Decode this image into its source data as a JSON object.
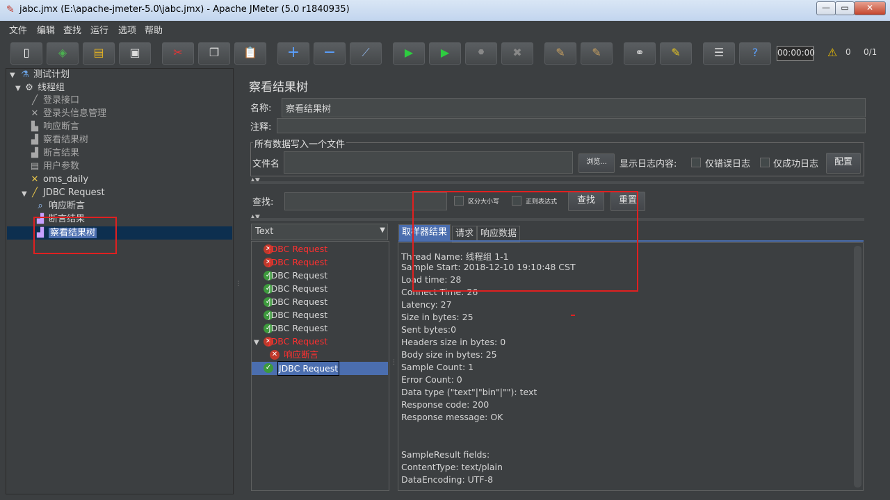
{
  "window": {
    "title": "jabc.jmx (E:\\apache-jmeter-5.0\\jabc.jmx) - Apache JMeter (5.0 r1840935)"
  },
  "menu": [
    "文件",
    "编辑",
    "查找",
    "运行",
    "选项",
    "帮助"
  ],
  "toolbar": {
    "timer": "00:00:00",
    "warning_count": "0",
    "thread_count": "0/1"
  },
  "tree": [
    {
      "label": "测试计划",
      "icon": "flask-icon"
    },
    {
      "label": "线程组",
      "icon": "gear-icon"
    },
    {
      "label": "登录接口",
      "icon": "pipette-icon"
    },
    {
      "label": "登录头信息管理",
      "icon": "tools-icon"
    },
    {
      "label": "响应断言",
      "icon": "stamp-icon"
    },
    {
      "label": "察看结果树",
      "icon": "graph-icon"
    },
    {
      "label": "断言结果",
      "icon": "graph-icon"
    },
    {
      "label": "用户参数",
      "icon": "doc-icon"
    },
    {
      "label": "oms_daily",
      "icon": "tools-icon"
    },
    {
      "label": "JDBC Request",
      "icon": "pipette-icon"
    },
    {
      "label": "响应断言",
      "icon": "magnifier-icon"
    },
    {
      "label": "断言结果",
      "icon": "graph-icon"
    },
    {
      "label": "察看结果树",
      "icon": "graph-icon"
    }
  ],
  "panel": {
    "title": "察看结果树",
    "name_label": "名称:",
    "name_value": "察看结果树",
    "comment_label": "注释:",
    "file_group": "所有数据写入一个文件",
    "filename_label": "文件名",
    "browse": "浏览...",
    "log_label": "显示日志内容:",
    "errors_only": "仅错误日志",
    "success_only": "仅成功日志",
    "configure": "配置",
    "search_label": "查找:",
    "case_sensitive": "区分大小写",
    "regex": "正则表达式",
    "find": "查找",
    "reset": "重置",
    "renderer": "Text",
    "tabs": [
      "取样器结果",
      "请求",
      "响应数据"
    ]
  },
  "results": [
    {
      "label": "JDBC Request",
      "status": "error"
    },
    {
      "label": "JDBC Request",
      "status": "error"
    },
    {
      "label": "JDBC Request",
      "status": "ok"
    },
    {
      "label": "JDBC Request",
      "status": "ok"
    },
    {
      "label": "JDBC Request",
      "status": "ok"
    },
    {
      "label": "JDBC Request",
      "status": "ok"
    },
    {
      "label": "JDBC Request",
      "status": "ok"
    },
    {
      "label": "JDBC Request",
      "status": "error"
    },
    {
      "label": "响应断言",
      "status": "error"
    },
    {
      "label": "JDBC Request",
      "status": "ok"
    }
  ],
  "sampler_result": [
    "Thread Name: 线程组 1-1",
    "Sample Start: 2018-12-10 19:10:48 CST",
    "Load time: 28",
    "Connect Time: 26",
    "Latency: 27",
    "Size in bytes: 25",
    "Sent bytes:0",
    "Headers size in bytes: 0",
    "Body size in bytes: 25",
    "Sample Count: 1",
    "Error Count: 0",
    "Data type (\"text\"|\"bin\"|\"\"): text",
    "Response code: 200",
    "Response message: OK",
    "",
    "SampleResult fields:",
    "ContentType: text/plain",
    "DataEncoding: UTF-8"
  ]
}
